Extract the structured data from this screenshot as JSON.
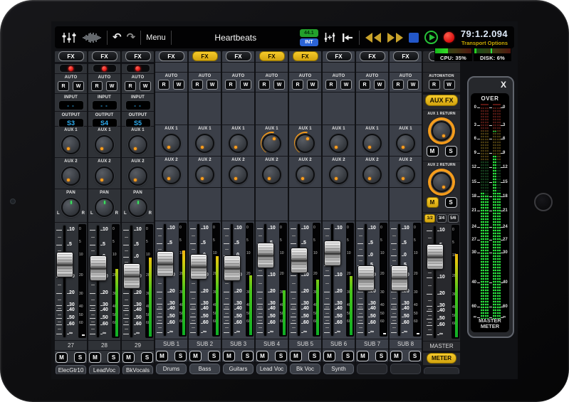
{
  "toolbar": {
    "menu": "Menu",
    "title": "Heartbeats",
    "badges": {
      "sample_rate": "44.1",
      "sync": "INT"
    },
    "undo_glyph": "↶",
    "redo_glyph": "↷",
    "timecode": "79:1.2.094",
    "transport_options": "Transport Options",
    "icons": [
      "mixer-icon",
      "waveform-icon",
      "undo-icon",
      "redo-icon",
      "menu-button",
      "channel-strip-icon",
      "return-to-zero-icon",
      "rewind-icon",
      "fast-forward-icon",
      "stop-icon",
      "play-icon",
      "record-icon"
    ]
  },
  "status_meters": {
    "cpu": {
      "label": "CPU: 35%",
      "percent": 35
    },
    "disk": {
      "label": "DISK: 6%",
      "percent": 6
    }
  },
  "strip_labels": {
    "fx": "FX",
    "auto": "AUTO",
    "read": "R",
    "write": "W",
    "input": "INPUT",
    "output": "OUTPUT",
    "aux1": "AUX 1",
    "aux2": "AUX 2",
    "pan": "PAN",
    "pan_left": "L",
    "pan_right": "R",
    "mute": "M",
    "solo": "S"
  },
  "fader_scale": [
    "10",
    "5",
    "0",
    "5",
    "10",
    "20",
    "30",
    "40",
    "50",
    "60",
    "∞"
  ],
  "channel_meter_scale": [
    "0",
    "5",
    "10",
    "20",
    "30",
    "40",
    "50",
    "60"
  ],
  "channels": [
    {
      "number": "27",
      "name": "ElecGtr10",
      "kind": "input",
      "fx_active": false,
      "record_armed": true,
      "input_value": "- -",
      "output_value": "S3",
      "aux1_arc": false,
      "fader_pos": 0.35,
      "meter_level": 0.0
    },
    {
      "number": "28",
      "name": "LeadVoc",
      "kind": "input",
      "fx_active": false,
      "record_armed": true,
      "input_value": "- -",
      "output_value": "S4",
      "aux1_arc": false,
      "fader_pos": 0.385,
      "meter_level": 0.63
    },
    {
      "number": "29",
      "name": "BkVocals",
      "kind": "input",
      "fx_active": false,
      "record_armed": true,
      "input_value": "- -",
      "output_value": "S5",
      "aux1_arc": false,
      "fader_pos": 0.455,
      "meter_level": 0.74
    },
    {
      "number": "SUB 1",
      "name": "Drums",
      "kind": "sub",
      "fx_active": false,
      "aux1_arc": false,
      "fader_pos": 0.36,
      "meter_level": 0.79
    },
    {
      "number": "SUB 2",
      "name": "Bass",
      "kind": "sub",
      "fx_active": true,
      "aux1_arc": false,
      "fader_pos": 0.385,
      "meter_level": 0.74
    },
    {
      "number": "SUB 3",
      "name": "Guitars",
      "kind": "sub",
      "fx_active": false,
      "aux1_arc": false,
      "fader_pos": 0.4,
      "meter_level": 0.56
    },
    {
      "number": "SUB 4",
      "name": "Lead Voc",
      "kind": "sub",
      "fx_active": true,
      "aux1_arc": true,
      "fader_pos": 0.28,
      "meter_level": 0.42
    },
    {
      "number": "SUB 5",
      "name": "Bk Voc",
      "kind": "sub",
      "fx_active": true,
      "aux1_arc": true,
      "fader_pos": 0.33,
      "meter_level": 0.52
    },
    {
      "number": "SUB 6",
      "name": "Synth",
      "kind": "sub",
      "fx_active": false,
      "aux1_arc": false,
      "fader_pos": 0.26,
      "meter_level": 0.55
    },
    {
      "number": "SUB 7",
      "name": "",
      "kind": "sub",
      "fx_active": false,
      "aux1_arc": false,
      "fader_pos": 0.49,
      "meter_level": 0.0
    },
    {
      "number": "SUB 8",
      "name": "",
      "kind": "sub",
      "fx_active": false,
      "aux1_arc": false,
      "fader_pos": 0.49,
      "meter_level": 0.0
    }
  ],
  "master": {
    "number": "MASTER",
    "automation": "AUTOMATION",
    "aux_fx": "AUX FX",
    "aux1_return": "AUX 1 RETURN",
    "aux2_return": "AUX 2 RETURN",
    "aux2_mute_active": true,
    "pair_buttons": [
      "1/2",
      "3/4",
      "5/6"
    ],
    "active_pair": "1/2",
    "meter_button": "METER",
    "fader_pos": 0.275,
    "meter_level": 0.78
  },
  "master_meter": {
    "close": "X",
    "over": "OVER",
    "scale": [
      "0",
      "3",
      "6",
      "9",
      "12",
      "15",
      "18",
      "21",
      "24",
      "27",
      "30",
      "40",
      "60",
      "∞"
    ],
    "caption_line1": "MASTER",
    "caption_line2": "METER",
    "bars": [
      {
        "level": 0.6
      },
      {
        "level": 0.59
      },
      {
        "level": 0.77,
        "peak": 0.89
      },
      {
        "level": 0.595
      }
    ]
  }
}
